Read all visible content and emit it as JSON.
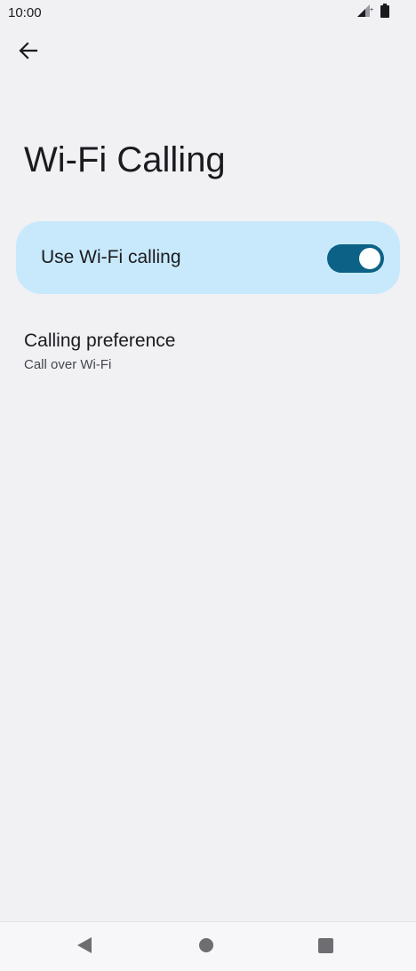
{
  "status_bar": {
    "time": "10:00",
    "icons": [
      "signal-icon",
      "battery-icon"
    ]
  },
  "header": {
    "back_icon": "arrow-back-icon"
  },
  "page": {
    "title": "Wi-Fi Calling"
  },
  "wifi_calling": {
    "label": "Use Wi-Fi calling",
    "enabled": true
  },
  "calling_preference": {
    "title": "Calling preference",
    "value": "Call over Wi-Fi"
  },
  "nav": {
    "icons": [
      "nav-back-icon",
      "nav-home-icon",
      "nav-recents-icon"
    ]
  },
  "colors": {
    "background": "#f1f1f4",
    "card": "#c8e9fb",
    "toggle_on": "#0b6286"
  }
}
